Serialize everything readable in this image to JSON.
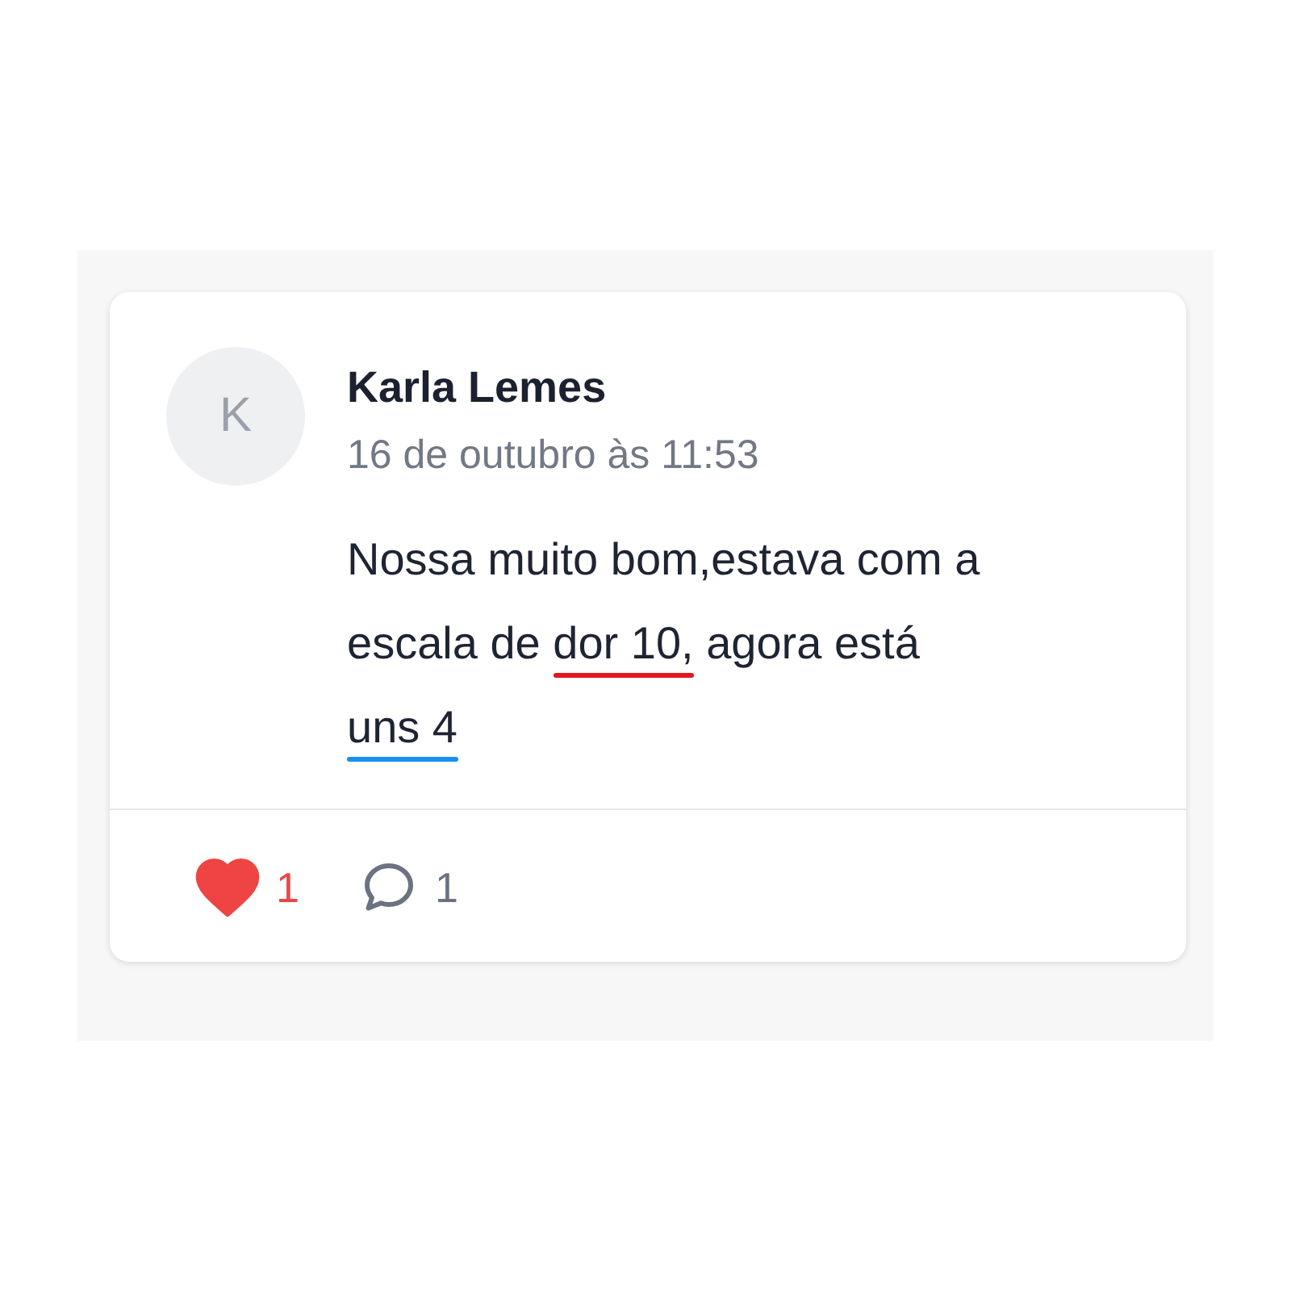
{
  "comment": {
    "avatar_letter": "K",
    "author": "Karla Lemes",
    "date": "16 de outubro às 11:53",
    "body_lines": [
      [
        {
          "text": "Nossa muito bom,estava com a"
        }
      ],
      [
        {
          "text": "escala de "
        },
        {
          "text": "dor 10,",
          "color": "#e3161f"
        },
        {
          "text": " agora está"
        }
      ],
      [
        {
          "text": "uns 4",
          "color": "#1a8ff0"
        }
      ]
    ],
    "likes": {
      "count": "1",
      "liked": true
    },
    "replies": {
      "count": "1"
    }
  }
}
